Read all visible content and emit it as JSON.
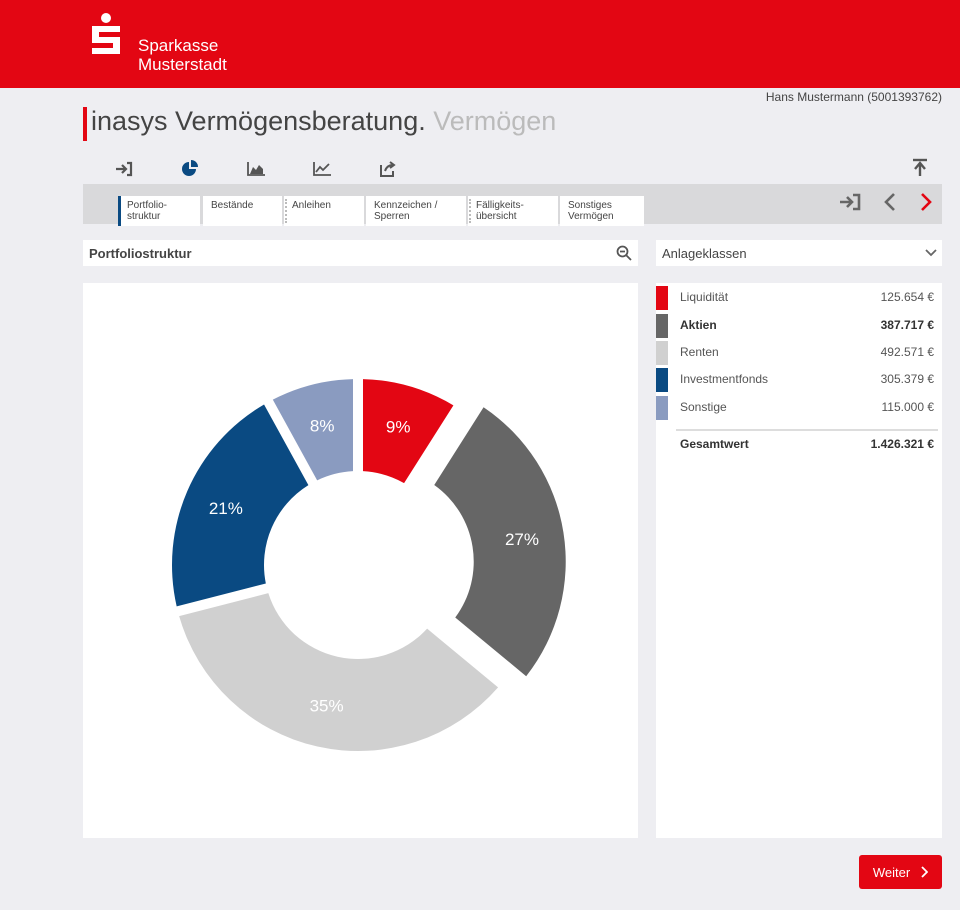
{
  "header": {
    "brand_line1": "Sparkasse",
    "brand_line2": "Musterstadt",
    "color": "#e30613"
  },
  "user": "Hans Mustermann (5001393762)",
  "title": {
    "main": "inasys Vermögensberatung.",
    "sub": "Vermögen"
  },
  "icon_tabs": [
    {
      "icon": "sign-in-icon",
      "active": false
    },
    {
      "icon": "pie-chart-icon",
      "active": true
    },
    {
      "icon": "area-chart-icon",
      "active": false
    },
    {
      "icon": "line-chart-icon",
      "active": false
    },
    {
      "icon": "share-icon",
      "active": false
    }
  ],
  "sub_tabs": [
    {
      "line1": "Portfolio-",
      "line2": "struktur",
      "active": true
    },
    {
      "line1": "Bestände",
      "line2": ""
    },
    {
      "line1": "Anleihen",
      "line2": ""
    },
    {
      "line1": "Kennzeichen /",
      "line2": "Sperren"
    },
    {
      "line1": "Fälligkeits-",
      "line2": "übersicht"
    },
    {
      "line1": "Sonstiges",
      "line2": "Vermögen"
    }
  ],
  "left_panel": {
    "title": "Portfoliostruktur"
  },
  "right_panel": {
    "selected": "Anlageklassen"
  },
  "legend": [
    {
      "label": "Liquidität",
      "value": "125.654 €",
      "color": "#e30613",
      "bold": false
    },
    {
      "label": "Aktien",
      "value": "387.717 €",
      "color": "#666666",
      "bold": true
    },
    {
      "label": "Renten",
      "value": "492.571 €",
      "color": "#d0d0d0",
      "bold": false
    },
    {
      "label": "Investmentfonds",
      "value": "305.379 €",
      "color": "#0a4a82",
      "bold": false
    },
    {
      "label": "Sonstige",
      "value": "115.000 €",
      "color": "#8a9bc0",
      "bold": false
    }
  ],
  "total": {
    "label": "Gesamtwert",
    "value": "1.426.321 €"
  },
  "chart_data": {
    "type": "pie",
    "categories": [
      "Liquidität",
      "Aktien",
      "Renten",
      "Investmentfonds",
      "Sonstige"
    ],
    "values": [
      9,
      27,
      35,
      21,
      8
    ],
    "labels": [
      "9%",
      "27%",
      "35%",
      "21%",
      "8%"
    ],
    "colors": [
      "#e30613",
      "#666666",
      "#d0d0d0",
      "#0a4a82",
      "#8a9bc0"
    ],
    "exploded": "Aktien"
  },
  "weiter_label": "Weiter"
}
